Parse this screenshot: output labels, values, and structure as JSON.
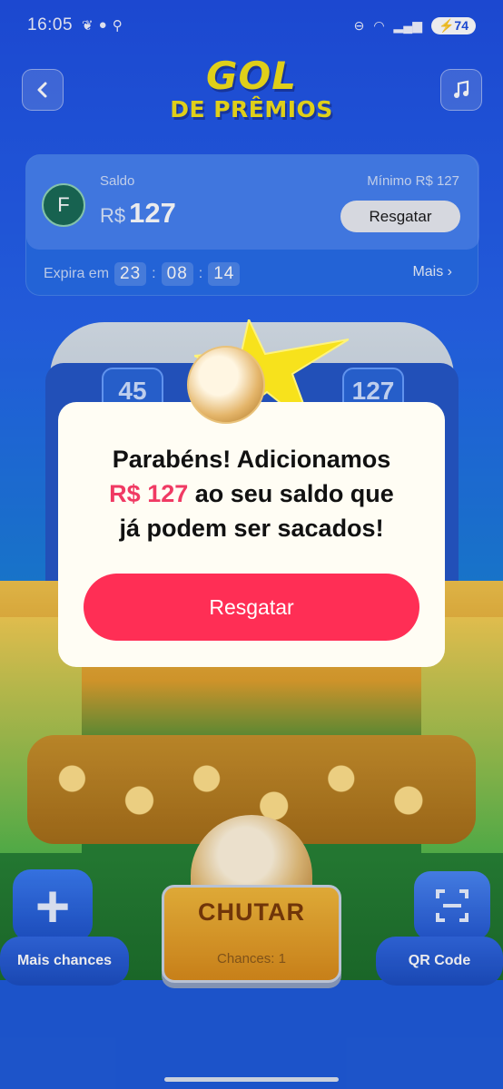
{
  "status_bar": {
    "time": "16:05",
    "battery": "74"
  },
  "header": {
    "logo_line1": "GOL",
    "logo_line2": "DE PRÊMIOS",
    "back_icon": "chevron-left-icon",
    "music_icon": "music-note-icon"
  },
  "balance": {
    "avatar_letter": "F",
    "label": "Saldo",
    "currency": "R$",
    "value": "127",
    "minimum_label": "Mínimo  R$ 127",
    "redeem_label": "Resgatar",
    "expires_label": "Expira em",
    "timer_h": "23",
    "timer_m": "08",
    "timer_s": "14",
    "more_label": "Mais"
  },
  "game": {
    "slot_left": "45",
    "slot_right": "127",
    "kick_label": "CHUTAR",
    "chances_label": "Chances: 1",
    "more_chances_label": "Mais chances",
    "qr_label": "QR Code"
  },
  "modal": {
    "line1": "Parabéns! Adicionamos",
    "amount": "R$ 127",
    "line2_rest": " ao seu saldo que",
    "line3": "já podem ser sacados!",
    "button_label": "Resgatar"
  },
  "colors": {
    "accent": "#ff2e55",
    "amount_color": "#f03a63",
    "background": "#2563ea",
    "logo": "#f2e11a"
  }
}
